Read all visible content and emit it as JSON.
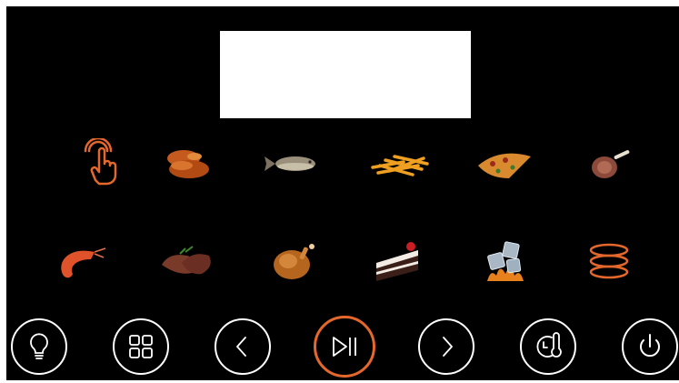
{
  "display": {
    "text": ""
  },
  "foods": [
    {
      "name": "manual-touch",
      "icon": "touch-hand-icon"
    },
    {
      "name": "chicken-wings",
      "icon": "chicken-wings-icon"
    },
    {
      "name": "fish",
      "icon": "fish-icon"
    },
    {
      "name": "french-fries",
      "icon": "fries-icon"
    },
    {
      "name": "pizza",
      "icon": "pizza-icon"
    },
    {
      "name": "lamb-chop",
      "icon": "lamb-chop-icon"
    },
    {
      "name": "shrimp",
      "icon": "shrimp-icon"
    },
    {
      "name": "steak",
      "icon": "steak-icon"
    },
    {
      "name": "roast-chicken",
      "icon": "roast-chicken-icon"
    },
    {
      "name": "cake",
      "icon": "cake-icon"
    },
    {
      "name": "defrost",
      "icon": "defrost-icon"
    },
    {
      "name": "heating-element",
      "icon": "heating-rings-icon"
    }
  ],
  "controls": [
    {
      "name": "light",
      "icon": "lightbulb-icon"
    },
    {
      "name": "menu",
      "icon": "grid-icon"
    },
    {
      "name": "previous",
      "icon": "chevron-left-icon"
    },
    {
      "name": "play-pause",
      "icon": "play-pause-icon"
    },
    {
      "name": "next",
      "icon": "chevron-right-icon"
    },
    {
      "name": "timer-temperature",
      "icon": "timer-thermometer-icon"
    },
    {
      "name": "power",
      "icon": "power-icon"
    }
  ],
  "colors": {
    "accent": "#e4672c",
    "background": "#000000",
    "display": "#ffffff"
  }
}
